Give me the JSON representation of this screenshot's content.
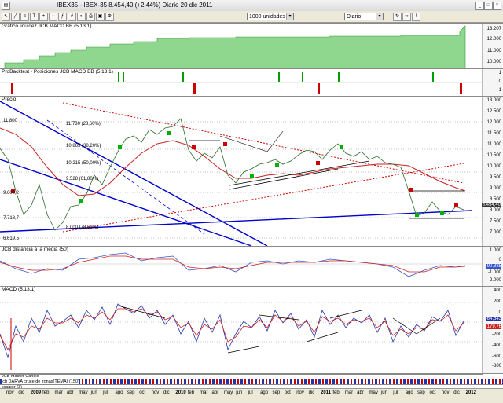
{
  "window": {
    "symbol": "IBEX35",
    "title": "IBEX35 - IBEX-35   8.454,40 (+2,44%)   Diario 20 dic 2011"
  },
  "toolbar": {
    "units": "1000 unidades",
    "period": "Diario"
  },
  "panels": {
    "liquidity": {
      "label": "Gráfico liquidez  JCB MACD BB (5.13.1)",
      "ticks": [
        "13.207",
        "12.000",
        "11.000",
        "10.000"
      ]
    },
    "positions": {
      "label": "ProBacktest - Posiciones  JCB MACD BB (5.13.1)",
      "ticks": [
        "1",
        "0",
        "-1"
      ]
    },
    "price": {
      "label": "Precio",
      "last_value": "8.454,40",
      "ticks": [
        "13.000",
        "12.500",
        "12.000",
        "11.500",
        "11.000",
        "10.500",
        "10.000",
        "9.500",
        "9.000",
        "8.500",
        "8.000",
        "7.500",
        "7.000"
      ],
      "annotations": [
        "11.800",
        "11.730 (23,60%)",
        "10.865 (38,20%)",
        "10.215 (50,00%)",
        "9.528 (61,80%)",
        "9.000,2",
        "7.718,7",
        "6.619,5",
        "8.000 (78,60%)"
      ]
    },
    "distance": {
      "label": "JCB distancia a la media (50)",
      "ticks": [
        "1.000",
        "0",
        "-1.000",
        "-2.000"
      ],
      "value": "-90,885"
    },
    "macd": {
      "label": "MACD (5.13.1)",
      "ticks": [
        "400",
        "200",
        "0",
        "-200",
        "-400",
        "-600",
        "-800"
      ],
      "values": [
        "-64,643",
        "-179,76"
      ]
    },
    "master": {
      "label": "JCB Master  Candle"
    },
    "darva": {
      "label": "jcb DARVA cruce de zonas(TEMA) (150)"
    },
    "scalper": {
      "label": "scalper (3)"
    }
  },
  "x_axis": {
    "labels": [
      "nov",
      "dic",
      "2009",
      "feb",
      "mar",
      "abr",
      "may",
      "jun",
      "jul",
      "ago",
      "sep",
      "oct",
      "nov",
      "dic",
      "2010",
      "feb",
      "mar",
      "abr",
      "may",
      "jun",
      "jul",
      "ago",
      "sep",
      "oct",
      "nov",
      "dic",
      "2011",
      "feb",
      "mar",
      "abr",
      "may",
      "jun",
      "jul",
      "ago",
      "sep",
      "oct",
      "nov",
      "dic",
      "2012"
    ]
  },
  "colors": {
    "price_up": "#00a000",
    "price_down": "#cc0000",
    "trend_blue": "#0000cc",
    "ma_red": "#cc2222",
    "liquidity_fill": "#8fd68f"
  }
}
